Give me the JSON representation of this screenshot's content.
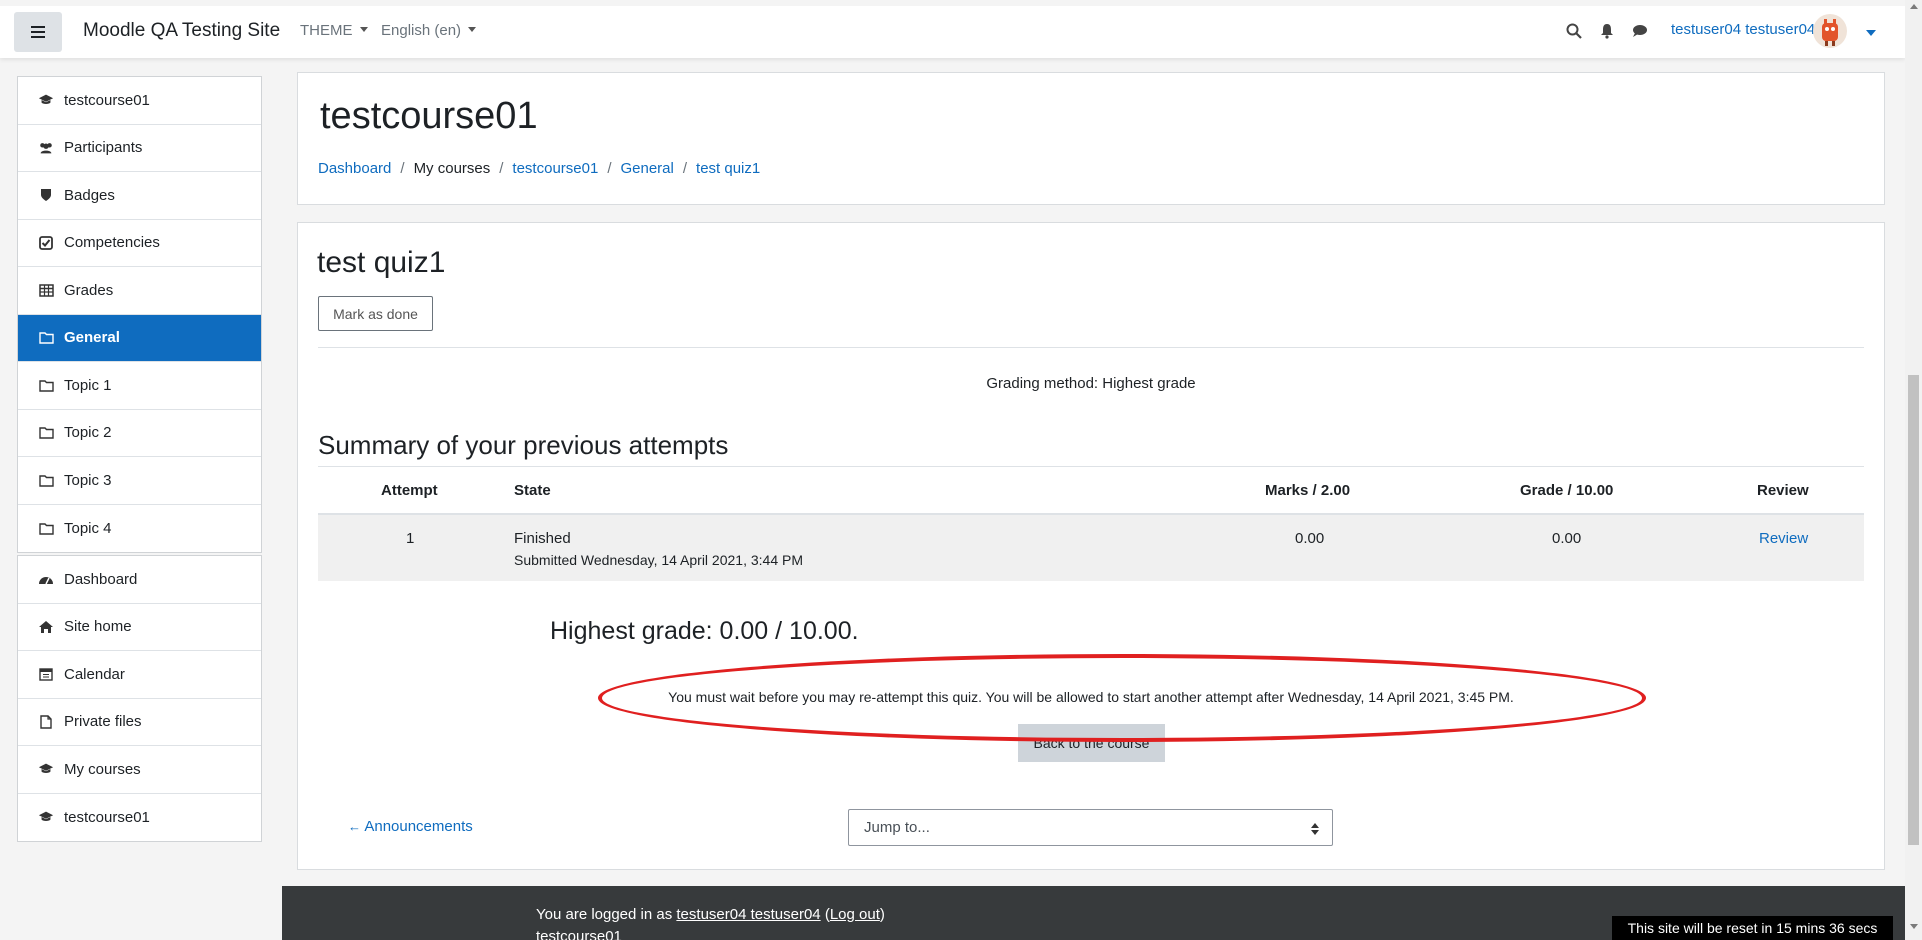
{
  "navbar": {
    "site_name": "Moodle QA Testing Site",
    "theme_label": "THEME",
    "language_label": "English (en)",
    "user_name": "testuser04 testuser04"
  },
  "drawer": {
    "course_items": [
      {
        "label": "testcourse01",
        "icon": "graduation-cap-icon"
      },
      {
        "label": "Participants",
        "icon": "users-icon"
      },
      {
        "label": "Badges",
        "icon": "shield-icon"
      },
      {
        "label": "Competencies",
        "icon": "check-square-icon"
      },
      {
        "label": "Grades",
        "icon": "table-icon"
      },
      {
        "label": "General",
        "icon": "folder-icon",
        "active": true
      },
      {
        "label": "Topic 1",
        "icon": "folder-icon"
      },
      {
        "label": "Topic 2",
        "icon": "folder-icon"
      },
      {
        "label": "Topic 3",
        "icon": "folder-icon"
      },
      {
        "label": "Topic 4",
        "icon": "folder-icon"
      }
    ],
    "site_items": [
      {
        "label": "Dashboard",
        "icon": "tachometer-icon"
      },
      {
        "label": "Site home",
        "icon": "home-icon"
      },
      {
        "label": "Calendar",
        "icon": "calendar-icon"
      },
      {
        "label": "Private files",
        "icon": "file-icon"
      },
      {
        "label": "My courses",
        "icon": "graduation-cap-icon"
      },
      {
        "label": "testcourse01",
        "icon": "graduation-cap-icon"
      }
    ]
  },
  "header": {
    "course_title": "testcourse01",
    "breadcrumb": [
      "Dashboard",
      "My courses",
      "testcourse01",
      "General",
      "test quiz1"
    ]
  },
  "quiz": {
    "title": "test quiz1",
    "mark_done_label": "Mark as done",
    "grading_method": "Grading method: Highest grade",
    "summary_title": "Summary of your previous attempts",
    "columns": [
      "Attempt",
      "State",
      "Marks / 2.00",
      "Grade / 10.00",
      "Review"
    ],
    "attempt": {
      "number": "1",
      "state": "Finished",
      "submitted": "Submitted Wednesday, 14 April 2021, 3:44 PM",
      "marks": "0.00",
      "grade": "0.00",
      "review": "Review"
    },
    "highest_grade": "Highest grade: 0.00 / 10.00.",
    "wait_message": "You must wait before you may re-attempt this quiz. You will be allowed to start another attempt after Wednesday, 14 April 2021, 3:45 PM.",
    "back_button": "Back to the course"
  },
  "navigation": {
    "prev_link": "Announcements",
    "jump_placeholder": "Jump to..."
  },
  "footer": {
    "logged_in_prefix": "You are logged in as ",
    "user_link": "testuser04 testuser04",
    "logout_open": " (",
    "logout_link": "Log out",
    "logout_close": ")",
    "course": "testcourse01",
    "reset_notice": "This site will be reset in 15 mins 36 secs"
  },
  "colors": {
    "primary": "#0f6cbf",
    "annotation": "#e02020",
    "footer_bg": "#373a3c"
  }
}
